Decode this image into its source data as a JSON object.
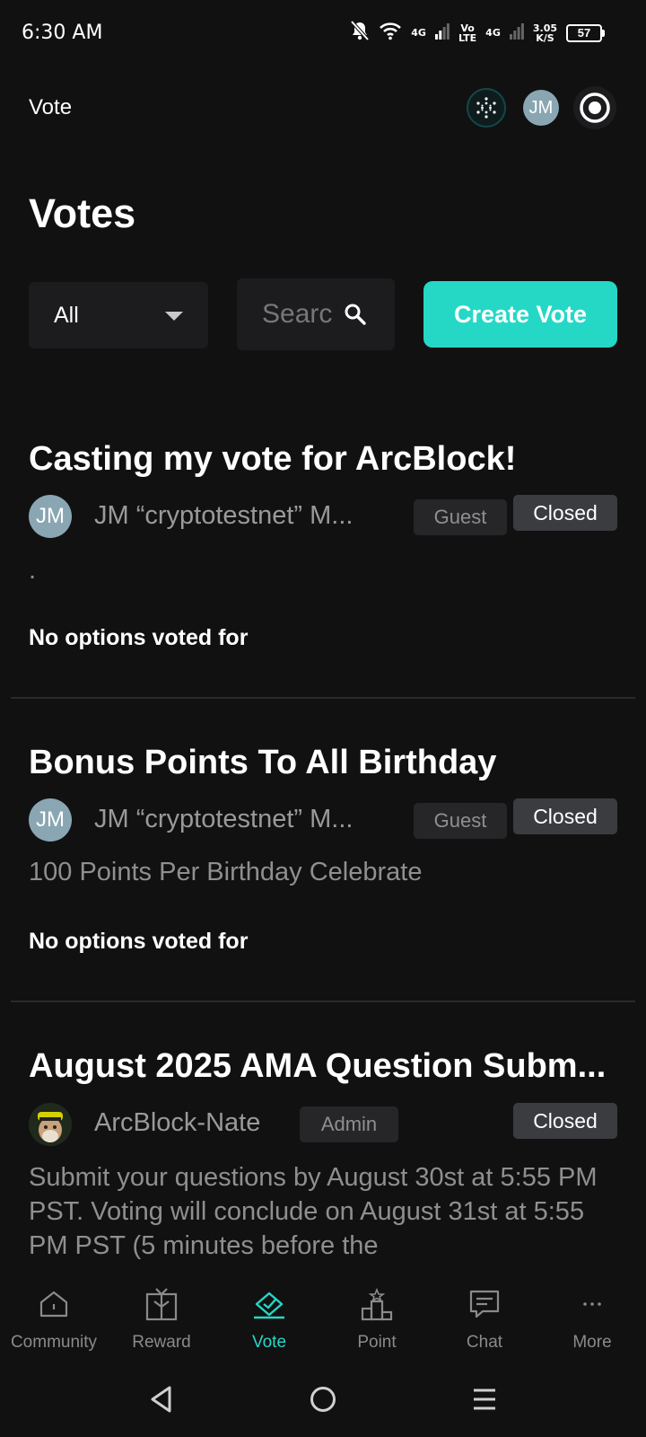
{
  "status_bar": {
    "time": "6:30 AM",
    "net1": "4G",
    "volte_top": "Vo",
    "volte_bottom": "LTE",
    "net2": "4G",
    "speed_top": "3.05",
    "speed_bottom": "K/S",
    "battery": "57",
    "icons": [
      "bell-off-icon",
      "wifi-icon",
      "signal-icon",
      "signal-icon",
      "battery-icon"
    ]
  },
  "header": {
    "title": "Vote",
    "avatar_initials": "JM",
    "icons": [
      "network-logo-icon",
      "avatar",
      "record-icon"
    ]
  },
  "page_title": "Votes",
  "toolbar": {
    "filter_value": "All",
    "search_placeholder": "Search",
    "create_label": "Create Vote"
  },
  "votes": [
    {
      "title": "Casting my vote for ArcBlock!",
      "author_initials": "JM",
      "author": "JM “cryptotestnet” M...",
      "role": "Guest",
      "status": "Closed",
      "description": ".",
      "summary": "No options voted for"
    },
    {
      "title": "Bonus Points To All Birthday",
      "author_initials": "JM",
      "author": "JM “cryptotestnet” M...",
      "role": "Guest",
      "status": "Closed",
      "description": "100 Points Per Birthday Celebrate",
      "summary": "No options voted for"
    },
    {
      "title": "August 2025 AMA Question Subm...",
      "author": "ArcBlock-Nate",
      "role": "Admin",
      "status": "Closed",
      "description": "Submit your questions by August 30st at 5:55 PM PST. Voting will conclude on August 31st at 5:55 PM PST (5 minutes before the"
    }
  ],
  "bottom_nav": [
    {
      "label": "Community",
      "icon": "home-icon",
      "active": false
    },
    {
      "label": "Reward",
      "icon": "gift-icon",
      "active": false
    },
    {
      "label": "Vote",
      "icon": "ballot-check-icon",
      "active": true
    },
    {
      "label": "Point",
      "icon": "podium-icon",
      "active": false
    },
    {
      "label": "Chat",
      "icon": "chat-icon",
      "active": false
    },
    {
      "label": "More",
      "icon": "more-dots-icon",
      "active": false
    }
  ],
  "colors": {
    "background": "#111112",
    "accent": "#25d8c6",
    "muted_text": "#9a9a9a",
    "badge_bg": "#3b3c40"
  }
}
